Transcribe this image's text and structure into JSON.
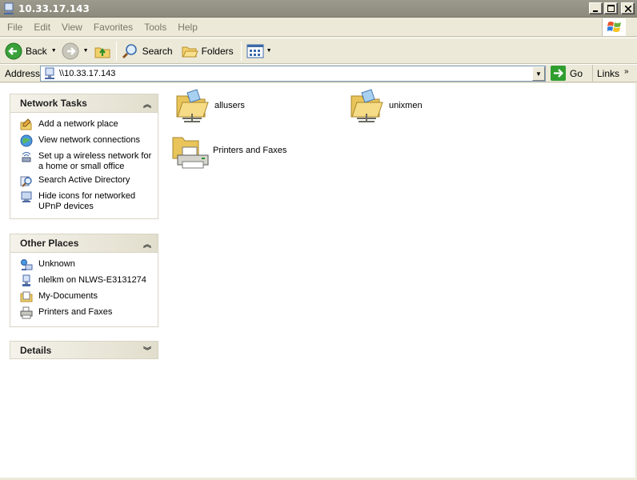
{
  "window": {
    "title": "10.33.17.143"
  },
  "menu": [
    "File",
    "Edit",
    "View",
    "Favorites",
    "Tools",
    "Help"
  ],
  "toolbar": {
    "back": "Back",
    "search": "Search",
    "folders": "Folders"
  },
  "address": {
    "label": "Address",
    "value": "\\\\10.33.17.143",
    "go": "Go",
    "links": "Links"
  },
  "network_tasks": {
    "title": "Network Tasks",
    "items": [
      {
        "label": "Add a network place",
        "icon": "add-network-place-icon"
      },
      {
        "label": "View network connections",
        "icon": "network-connections-icon"
      },
      {
        "label": "Set up a wireless network for a home or small office",
        "icon": "wireless-network-icon"
      },
      {
        "label": "Search Active Directory",
        "icon": "search-directory-icon"
      },
      {
        "label": "Hide icons for networked UPnP devices",
        "icon": "upnp-devices-icon"
      }
    ]
  },
  "other_places": {
    "title": "Other Places",
    "items": [
      {
        "label": "Unknown",
        "icon": "network-icon"
      },
      {
        "label": "nlelkm on NLWS-E3131274",
        "icon": "computer-icon"
      },
      {
        "label": "My-Documents",
        "icon": "documents-icon"
      },
      {
        "label": "Printers and Faxes",
        "icon": "printer-icon"
      }
    ]
  },
  "details": {
    "title": "Details"
  },
  "content": {
    "items": [
      {
        "label": "allusers",
        "icon": "shared-folder-icon"
      },
      {
        "label": "unixmen",
        "icon": "shared-folder-icon"
      },
      {
        "label": "Printers and Faxes",
        "icon": "printers-faxes-folder-icon"
      }
    ]
  }
}
